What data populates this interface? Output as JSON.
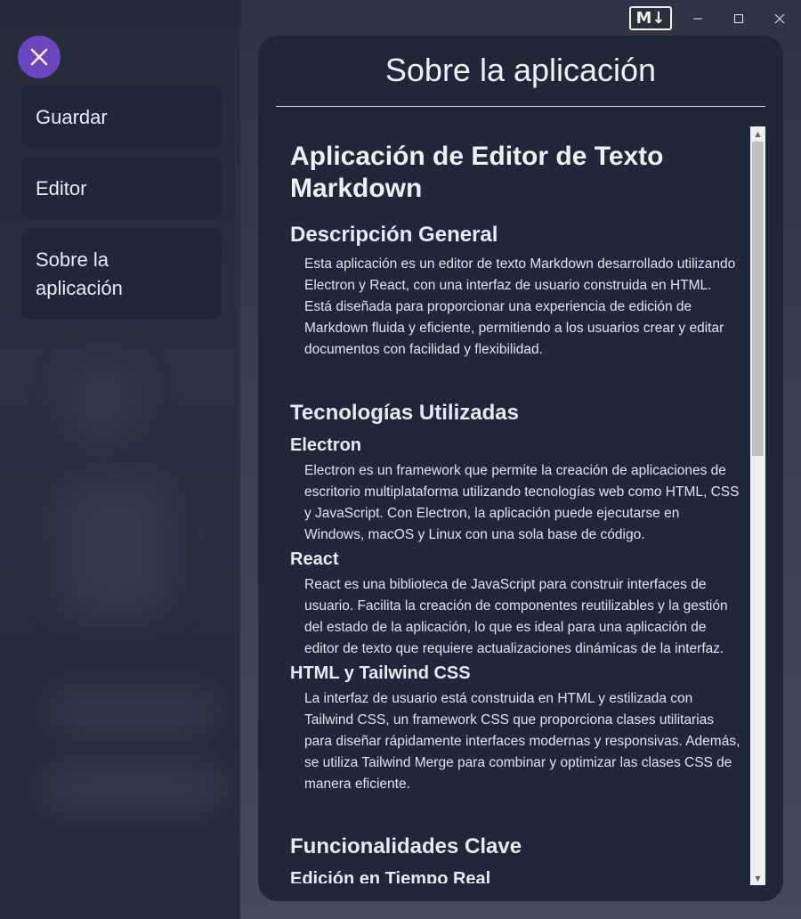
{
  "window": {
    "logo_text": "M↓",
    "controls": [
      "minimize-icon",
      "maximize-icon",
      "close-icon"
    ]
  },
  "sidebar": {
    "close_icon": "close-icon",
    "items": [
      {
        "label": "Guardar"
      },
      {
        "label": "Editor"
      },
      {
        "label": "Sobre la aplicación"
      }
    ]
  },
  "panel": {
    "title": "Sobre la aplicación",
    "doc": {
      "h1": "Aplicación de Editor de Texto Markdown",
      "sections": [
        {
          "title": "Descripción General",
          "paragraph": "Esta aplicación es un editor de texto Markdown desarrollado utilizando Electron y React, con una interfaz de usuario construida en HTML. Está diseñada para proporcionar una experiencia de edición de Markdown fluida y eficiente, permitiendo a los usuarios crear y editar documentos con facilidad y flexibilidad."
        },
        {
          "title": "Tecnologías Utilizadas",
          "subsections": [
            {
              "title": "Electron",
              "paragraph": "Electron es un framework que permite la creación de aplicaciones de escritorio multiplataforma utilizando tecnologías web como HTML, CSS y JavaScript. Con Electron, la aplicación puede ejecutarse en Windows, macOS y Linux con una sola base de código."
            },
            {
              "title": "React",
              "paragraph": "React es una biblioteca de JavaScript para construir interfaces de usuario. Facilita la creación de componentes reutilizables y la gestión del estado de la aplicación, lo que es ideal para una aplicación de editor de texto que requiere actualizaciones dinámicas de la interfaz."
            },
            {
              "title": "HTML y Tailwind CSS",
              "paragraph": "La interfaz de usuario está construida en HTML y estilizada con Tailwind CSS, un framework CSS que proporciona clases utilitarias para diseñar rápidamente interfaces modernas y responsivas. Además, se utiliza Tailwind Merge para combinar y optimizar las clases CSS de manera eficiente."
            }
          ]
        },
        {
          "title": "Funcionalidades Clave",
          "subsections": [
            {
              "title": "Edición en Tiempo Real"
            }
          ]
        }
      ]
    }
  },
  "colors": {
    "accent": "#6b46c1",
    "panel_bg": "#1f2838",
    "sidebar_bg": "#262c39"
  }
}
